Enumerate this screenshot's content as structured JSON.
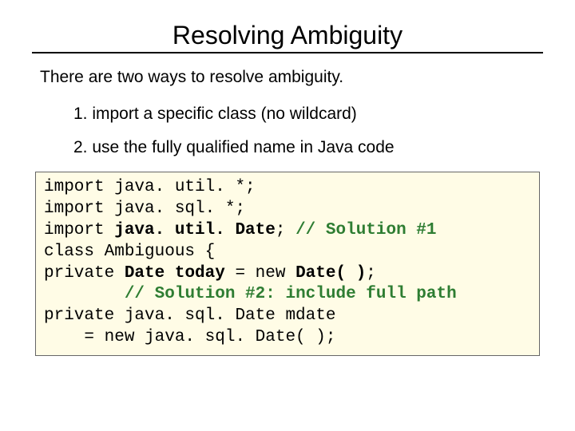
{
  "title": "Resolving Ambiguity",
  "intro": "There are two ways to resolve ambiguity.",
  "points": {
    "p1": "1.  import a specific class (no wildcard)",
    "p2": "2.  use the fully qualified name in Java code"
  },
  "code": {
    "l1a": "import java. util. *;",
    "l2a": "import java. sql. *;",
    "l3a": "import ",
    "l3b": "java. util. Date",
    "l3c": "; ",
    "l3d": "// Solution #1",
    "l4a": "class Ambiguous {",
    "l5a": "private ",
    "l5b": "Date today",
    "l5c": " = new ",
    "l5d": "Date( )",
    "l5e": ";",
    "l6a": "        ",
    "l6b": "// Solution #2: include full path",
    "l7a": "private java. sql. Date mdate",
    "l8a": "    = new java. sql. Date( );"
  }
}
